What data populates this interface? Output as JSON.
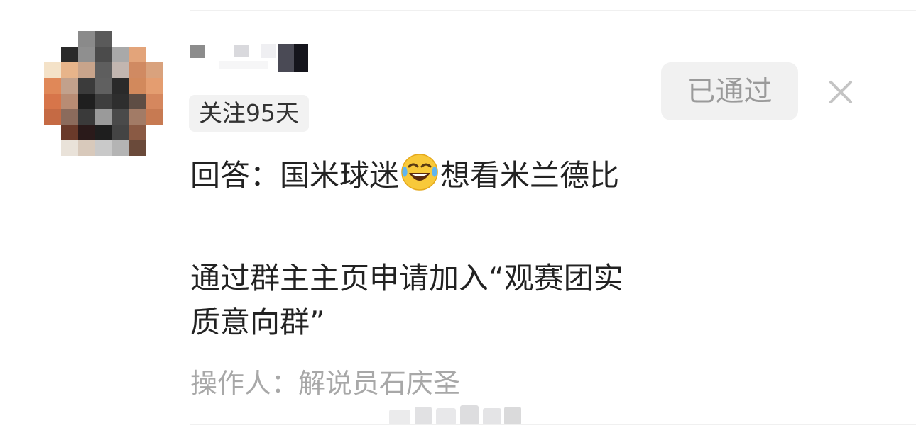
{
  "request": {
    "follow_badge": "关注95天",
    "answer_prefix": "回答：国米球迷",
    "answer_emoji": "face-with-tears-of-joy-icon",
    "answer_suffix": "想看米兰德比",
    "note": "通过群主主页申请加入“观赛团实质意向群”",
    "operator": "操作人：解说员石庆圣"
  },
  "actions": {
    "approved_label": "已通过",
    "dismiss_icon": "close-icon"
  },
  "colors": {
    "badge_bg": "#f2f2f2",
    "button_bg": "#f1f1f1",
    "muted_text": "#a8a8a8",
    "primary_text": "#222222"
  }
}
